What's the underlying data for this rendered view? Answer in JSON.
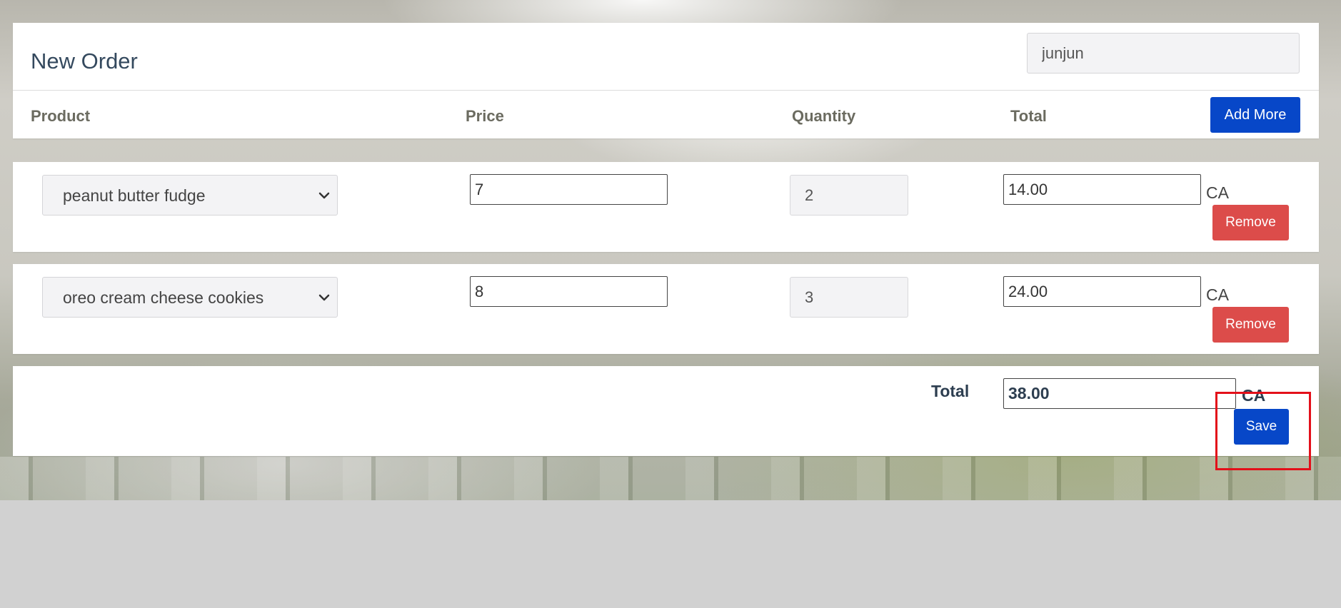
{
  "header": {
    "title": "New Order",
    "customer_value": "junjun",
    "columns": {
      "product": "Product",
      "price": "Price",
      "quantity": "Quantity",
      "total": "Total"
    },
    "add_more_label": "Add More"
  },
  "rows": [
    {
      "product": "peanut butter fudge",
      "price": "7",
      "quantity": "2",
      "total": "14.00",
      "currency": "CA",
      "remove_label": "Remove"
    },
    {
      "product": "oreo cream cheese cookies",
      "price": "8",
      "quantity": "3",
      "total": "24.00",
      "currency": "CA",
      "remove_label": "Remove"
    }
  ],
  "summary": {
    "total_label": "Total",
    "total_value": "38.00",
    "currency": "CA",
    "save_label": "Save"
  },
  "colors": {
    "primary": "#0747c8",
    "danger": "#dc4c4a",
    "highlight": "#e3101a",
    "title_text": "#34495e"
  }
}
